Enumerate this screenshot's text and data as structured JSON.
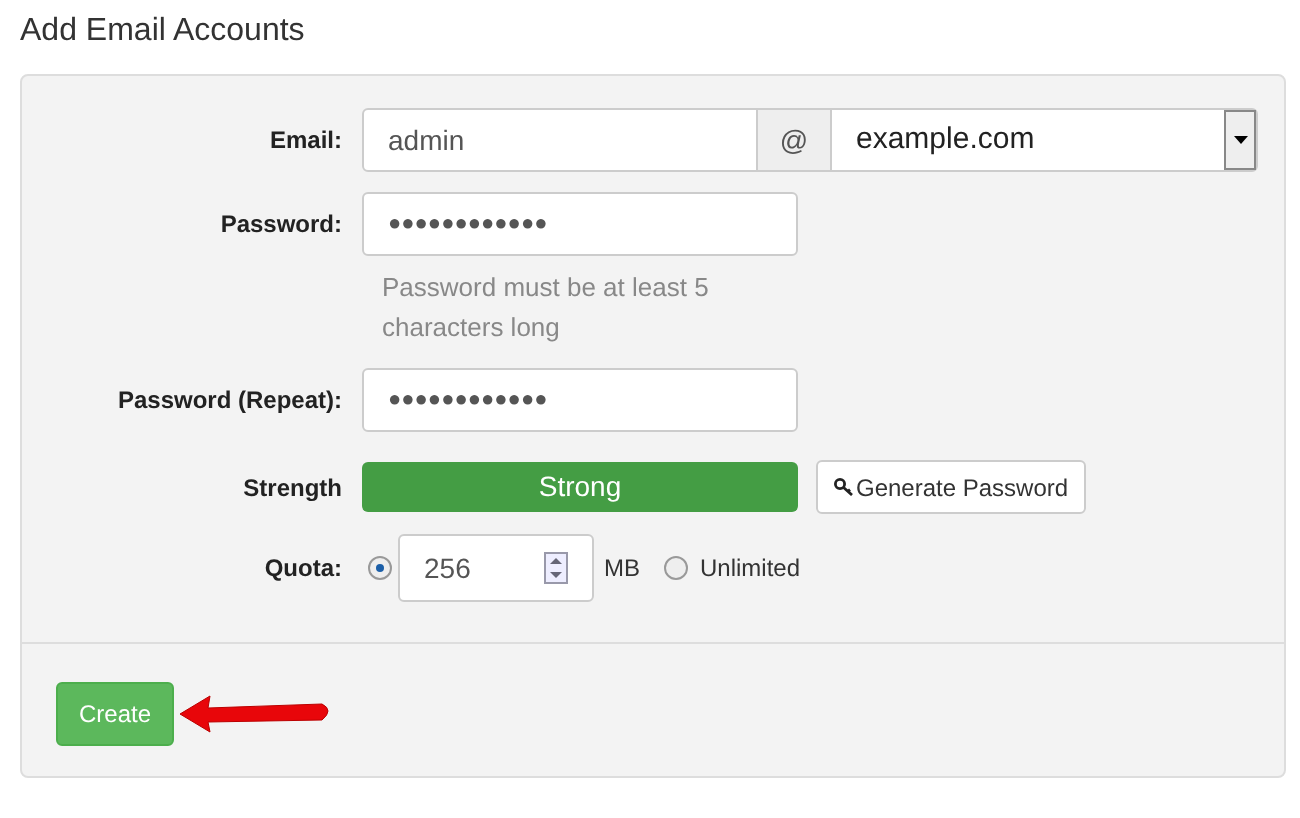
{
  "title": "Add Email Accounts",
  "email": {
    "label": "Email:",
    "value": "admin",
    "at": "@",
    "domain": "example.com"
  },
  "password": {
    "label": "Password:",
    "value": "●●●●●●●●●●●●",
    "help": "Password must be at least 5 characters long"
  },
  "password_repeat": {
    "label": "Password (Repeat):",
    "value": "●●●●●●●●●●●●"
  },
  "strength": {
    "label": "Strength",
    "text": "Strong",
    "level": 1,
    "generate_button": "Generate Password"
  },
  "quota": {
    "label": "Quota:",
    "options": [
      {
        "kind": "amount",
        "selected": true,
        "value": "256",
        "unit": "MB"
      },
      {
        "kind": "label",
        "selected": false,
        "text": "Unlimited"
      }
    ]
  },
  "create_button": "Create"
}
